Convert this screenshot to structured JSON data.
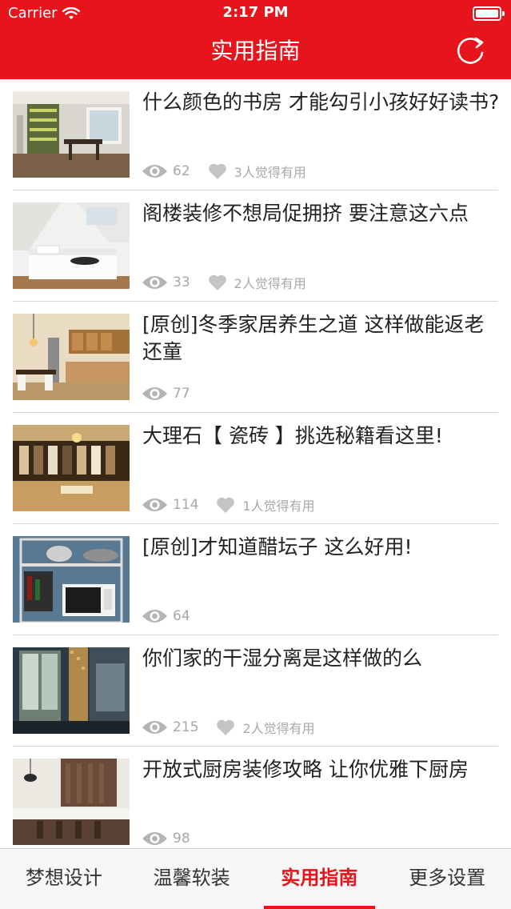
{
  "status_bar": {
    "carrier": "Carrier",
    "time": "2:17 PM"
  },
  "nav": {
    "title": "实用指南",
    "refresh_icon": "refresh-icon"
  },
  "colors": {
    "brand_red": "#e8141c",
    "meta_gray": "#a8a8a8",
    "title_text": "#222222"
  },
  "articles": [
    {
      "title": "什么颜色的书房 才能勾引小孩好好读书?",
      "views": "62",
      "likes": "3人觉得有用"
    },
    {
      "title": "阁楼装修不想局促拥挤 要注意这六点",
      "views": "33",
      "likes": "2人觉得有用"
    },
    {
      "title": "[原创]冬季家居养生之道 这样做能返老还童",
      "views": "77",
      "likes": ""
    },
    {
      "title": "大理石【 瓷砖 】挑选秘籍看这里!",
      "views": "114",
      "likes": "1人觉得有用"
    },
    {
      "title": "[原创]才知道醋坛子 这么好用!",
      "views": "64",
      "likes": ""
    },
    {
      "title": "你们家的干湿分离是这样做的么",
      "views": "215",
      "likes": "2人觉得有用"
    },
    {
      "title": "开放式厨房装修攻略 让你优雅下厨房",
      "views": "98",
      "likes": ""
    }
  ],
  "tabbar": {
    "tabs": [
      {
        "label": "梦想设计",
        "active": false
      },
      {
        "label": "温馨软装",
        "active": false
      },
      {
        "label": "实用指南",
        "active": true
      },
      {
        "label": "更多设置",
        "active": false
      }
    ]
  }
}
